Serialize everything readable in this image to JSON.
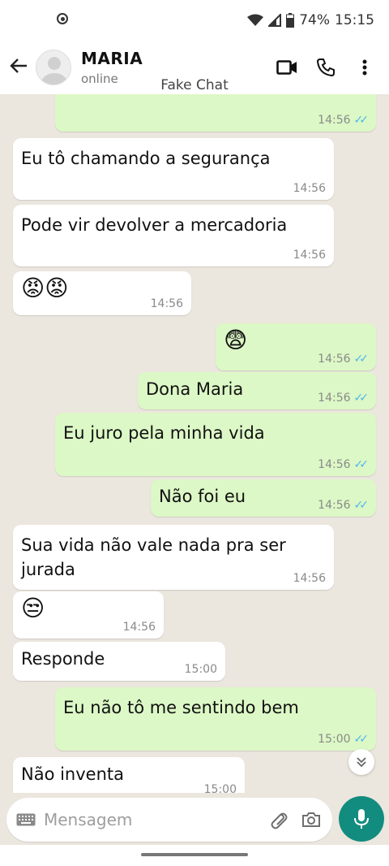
{
  "status_bar": {
    "battery": "74%",
    "time": "15:15"
  },
  "header": {
    "contact_name": "MARIA",
    "contact_status": "online",
    "watermark": "Fake Chat"
  },
  "messages": [
    {
      "dir": "out",
      "text": "",
      "time": "14:56",
      "read": true
    },
    {
      "dir": "in",
      "text": "Eu tô chamando a segurança",
      "time": "14:56"
    },
    {
      "dir": "in",
      "text": "Pode vir devolver a mercadoria",
      "time": "14:56"
    },
    {
      "dir": "in",
      "text": "😡😡",
      "time": "14:56"
    },
    {
      "dir": "out",
      "text": "😨",
      "time": "14:56",
      "read": true
    },
    {
      "dir": "out",
      "text": "Dona Maria",
      "time": "14:56",
      "read": true
    },
    {
      "dir": "out",
      "text": "Eu juro pela minha vida",
      "time": "14:56",
      "read": true
    },
    {
      "dir": "out",
      "text": "Não foi eu",
      "time": "14:56",
      "read": true
    },
    {
      "dir": "in",
      "text": "Sua vida não vale nada pra ser jurada",
      "time": "14:56"
    },
    {
      "dir": "in",
      "text": "😒",
      "time": "14:56"
    },
    {
      "dir": "in",
      "text": "Responde",
      "time": "15:00"
    },
    {
      "dir": "out",
      "text": "Eu não tô me sentindo bem",
      "time": "15:00",
      "read": true
    },
    {
      "dir": "in",
      "text": "Não inventa",
      "time": "15:00"
    }
  ],
  "composer": {
    "placeholder": "Mensagem"
  },
  "colors": {
    "outgoing_bubble": "#dcf8c6",
    "incoming_bubble": "#ffffff",
    "accent": "#128c7e",
    "read_ticks": "#4fb6ec"
  },
  "icons": [
    "back-arrow-icon",
    "video-call-icon",
    "phone-icon",
    "more-vert-icon",
    "keyboard-icon",
    "attach-icon",
    "camera-icon",
    "mic-icon",
    "double-chevron-down-icon"
  ]
}
